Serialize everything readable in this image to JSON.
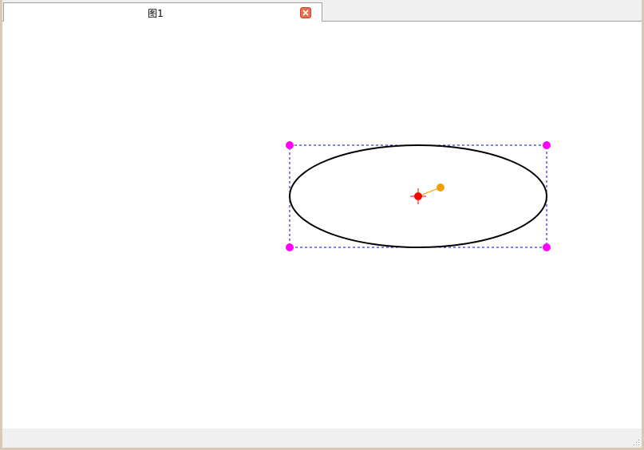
{
  "tabs": [
    {
      "label": "图1",
      "close_icon": "close-icon",
      "active": true
    }
  ],
  "colors": {
    "ellipse_stroke": "#000000",
    "bbox_stroke": "#0000cc",
    "handle_fill": "#ff00ff",
    "center_fill": "#ff0000",
    "rotation_fill": "#f0a000",
    "close_bg": "#e8704f"
  },
  "icons": {
    "handle": "resize-handle-icon",
    "center": "center-crosshair-icon",
    "rotation": "rotation-handle-icon",
    "grip": "resize-grip-icon"
  }
}
